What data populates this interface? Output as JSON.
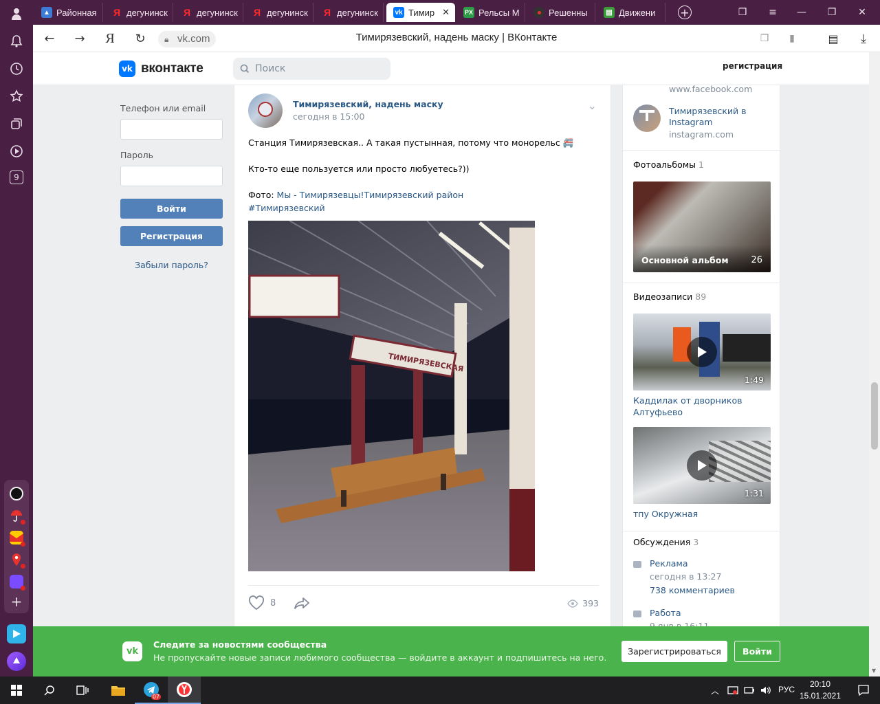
{
  "browser": {
    "tabs": [
      {
        "label": "Районная",
        "favicon": "район-icon",
        "color": "#3c7bd6"
      },
      {
        "label": "дегунинск",
        "favicon": "yandex-icon",
        "color": "#ff0000"
      },
      {
        "label": "дегунинск",
        "favicon": "yandex-icon",
        "color": "#ff0000"
      },
      {
        "label": "дегунинск",
        "favicon": "yandex-icon",
        "color": "#ff0000"
      },
      {
        "label": "дегунинск",
        "favicon": "yandex-icon",
        "color": "#ff0000"
      },
      {
        "label": "Тимир",
        "favicon": "vk-icon",
        "color": "#0077ff",
        "active": true
      },
      {
        "label": "Рельсы М",
        "favicon": "px-icon",
        "color": "#2e9c47"
      },
      {
        "label": "Решенны",
        "favicon": "pin-icon",
        "color": "#555555"
      },
      {
        "label": "Движени",
        "favicon": "flag-icon",
        "color": "#3c9c3c"
      }
    ],
    "url": "vk.com",
    "page_title": "Тимирязевский, надень маску | ВКонтакте",
    "rail_badge": "9"
  },
  "header": {
    "logo_text": "вконтакте",
    "search_placeholder": "Поиск",
    "register_link": "регистрация"
  },
  "login": {
    "phone_label": "Телефон или email",
    "password_label": "Пароль",
    "login_button": "Войти",
    "register_button": "Регистрация",
    "forgot_link": "Забыли пароль?"
  },
  "post": {
    "author": "Тимирязевский, надень маску",
    "time": "сегодня в 15:00",
    "text_line1": "Станция Тимирязевская.. А такая пустынная, потому что монорельс 🚝",
    "text_line2": "Кто-то еще пользуется или просто любуетесь?))",
    "photo_prefix": "Фото: ",
    "photo_link1": "Мы - Тимирязевцы!",
    "photo_link2": "Тимирязевский район",
    "hashtag": "#Тимирязевский",
    "likes": "8",
    "views": "393",
    "station_sign": "ТИМИРЯЗЕВСКАЯ"
  },
  "sidebar": {
    "facebook_url": "www.facebook.com",
    "instagram_title": "Тимирязевский в Instagram",
    "instagram_url": "instagram.com",
    "albums_title": "Фотоальбомы",
    "albums_count": "1",
    "album_name": "Основной альбом",
    "album_count": "26",
    "videos_title": "Видеозаписи",
    "videos_count": "89",
    "video1_duration": "1:49",
    "video1_title": "Каддилак от дворников Алтуфьево",
    "video2_duration": "1:31",
    "video2_title": "тпу Окружная",
    "discussions_title": "Обсуждения",
    "discussions_count": "3",
    "discussions": [
      {
        "title": "Реклама",
        "time": "сегодня в 13:27",
        "comments": "738 комментариев"
      },
      {
        "title": "Работа",
        "time": "9 янв в 16:11"
      }
    ]
  },
  "banner": {
    "title": "Следите за новостями сообщества",
    "subtitle": "Не пропускайте новые записи любимого сообщества — войдите в аккаунт и подпишитесь на него.",
    "register_button": "Зарегистрироваться",
    "login_button": "Войти"
  },
  "taskbar": {
    "telegram_badge": "07",
    "lang": "РУС",
    "time": "20:10",
    "date": "15.01.2021"
  },
  "colors": {
    "vk_blue": "#5181b8",
    "link": "#2a5885",
    "banner_green": "#4bb34b",
    "browser_purple": "#4a1f44"
  }
}
